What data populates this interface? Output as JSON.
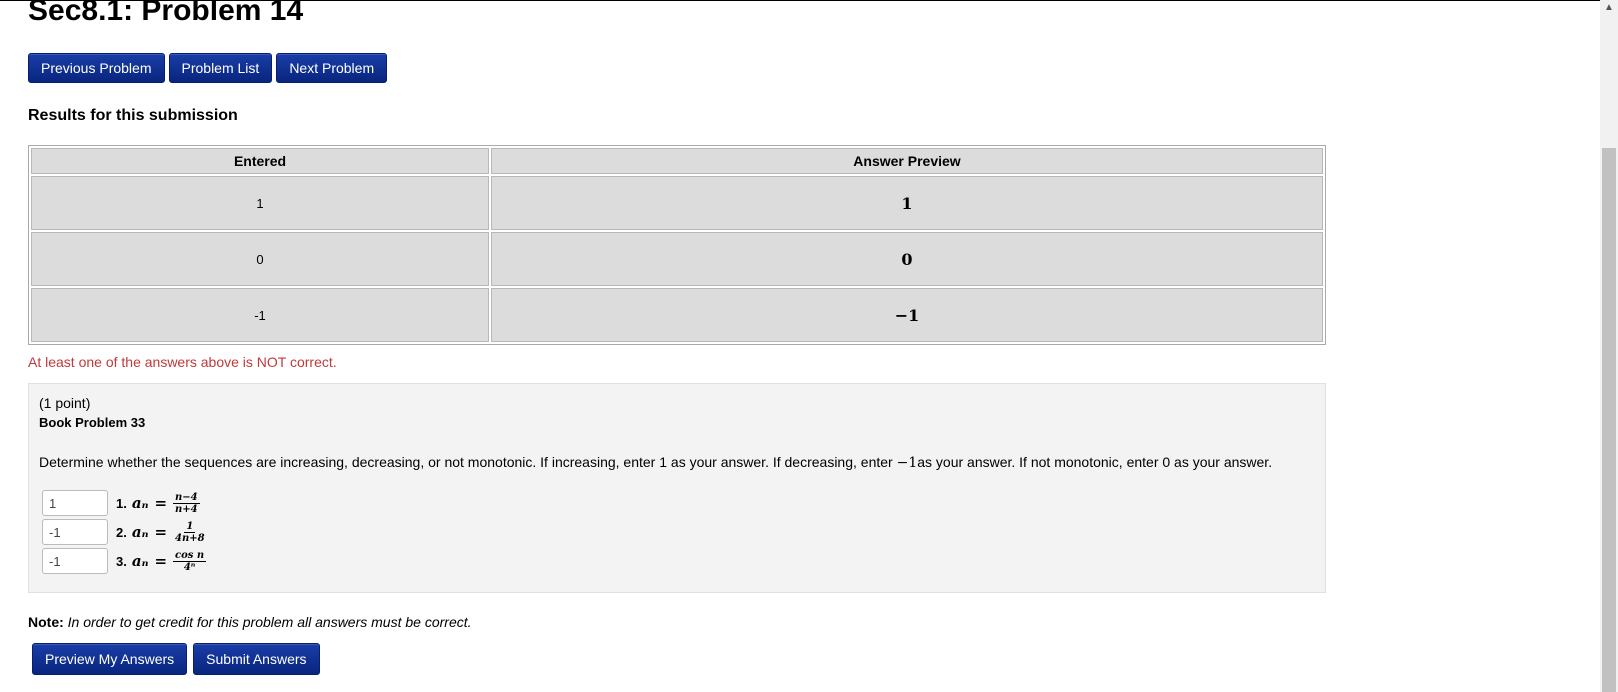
{
  "title": "Sec8.1: Problem 14",
  "nav": {
    "previous": "Previous Problem",
    "list": "Problem List",
    "next": "Next Problem"
  },
  "results": {
    "heading": "Results for this submission",
    "columns": [
      "Entered",
      "Answer Preview"
    ],
    "rows": [
      {
        "entered": "1",
        "preview": "1"
      },
      {
        "entered": "0",
        "preview": "0"
      },
      {
        "entered": "-1",
        "preview": "−1"
      }
    ],
    "message": "At least one of the answers above is NOT correct."
  },
  "problem": {
    "points": "(1 point)",
    "book": "Book Problem 33",
    "description_a": "Determine whether the sequences are increasing, decreasing, or not monotonic. If increasing, enter 1 as your answer. If decreasing, enter ",
    "description_math": "−1",
    "description_b": "as your answer. If not monotonic, enter 0 as your answer.",
    "questions": [
      {
        "value": "1",
        "label": "1.",
        "lhs": "aₙ",
        "eq": "=",
        "num": "n−4",
        "den": "n+4"
      },
      {
        "value": "-1",
        "label": "2.",
        "lhs": "aₙ",
        "eq": "=",
        "num": "1",
        "den": "4n+8"
      },
      {
        "value": "-1",
        "label": "3.",
        "lhs": "aₙ",
        "eq": "=",
        "num": "cos n",
        "den": "4ⁿ"
      }
    ]
  },
  "note": {
    "label": "Note:",
    "text": "In order to get credit for this problem all answers must be correct."
  },
  "actions": {
    "preview": "Preview My Answers",
    "submit": "Submit Answers"
  },
  "colors": {
    "button": "#0a2b8f",
    "warning": "#c0393b",
    "table_cell": "#dcdcdc",
    "problem_bg": "#f3f3f3"
  }
}
